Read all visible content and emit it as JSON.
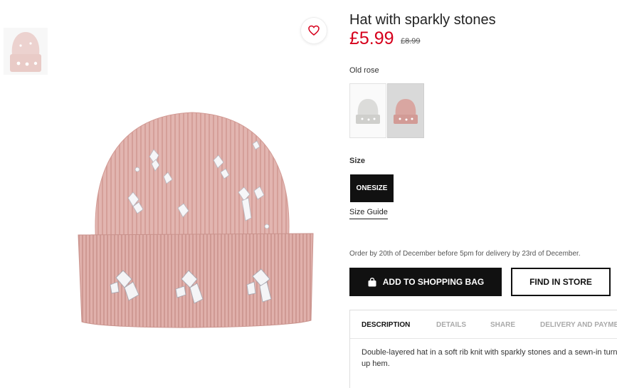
{
  "product": {
    "title": "Hat with sparkly stones",
    "price": "£5.99",
    "old_price": "£8.99"
  },
  "colour": {
    "selected_label": "Old rose",
    "swatches": [
      {
        "name": "grey",
        "color": "#d8d8d6"
      },
      {
        "name": "old rose",
        "color": "#dcaaa6"
      }
    ]
  },
  "size": {
    "label": "Size",
    "selected": "ONESIZE",
    "guide_link": "Size Guide"
  },
  "delivery_notice": "Order by 20th of December before 5pm for delivery by 23rd of December.",
  "actions": {
    "add_to_bag": "ADD TO SHOPPING BAG",
    "find_in_store": "FIND IN STORE"
  },
  "tabs": [
    {
      "label": "DESCRIPTION",
      "active": true
    },
    {
      "label": "DETAILS",
      "active": false
    },
    {
      "label": "SHARE",
      "active": false
    },
    {
      "label": "DELIVERY AND PAYMENT",
      "active": false
    }
  ],
  "description": {
    "line1": "Double-layered hat in a soft rib knit with sparkly stones and a sewn-in turn-",
    "line2": "up hem."
  },
  "icons": {
    "favorite": "heart-icon",
    "bag": "shopping-bag-icon"
  },
  "colors": {
    "price_red": "#d6001c",
    "button_black": "#111111",
    "hat_pink": "#e2b5b0"
  }
}
